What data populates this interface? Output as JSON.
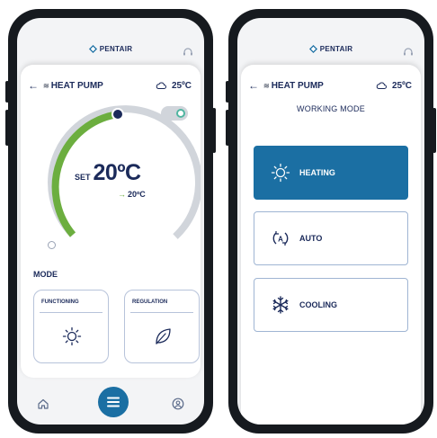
{
  "colors": {
    "brand_navy": "#1b2a5a",
    "accent_blue": "#1b6fa3",
    "arc_green": "#6cae3f",
    "arc_gray": "#d1d5db"
  },
  "brand": {
    "name": "PENTAIR"
  },
  "header": {
    "device_name": "HEAT PUMP",
    "outside_temp": "25ºC",
    "weather_icon": "cloud-icon",
    "support_icon": "headset-icon"
  },
  "thermostat": {
    "set_label": "SET",
    "set_value": "20ºC",
    "current_value": "20ºC",
    "arc_fill_fraction": 0.5,
    "power_on": true
  },
  "mode_section": {
    "title": "MODE",
    "tiles": [
      {
        "label": "FUNCTIONING",
        "icon": "sun-icon"
      },
      {
        "label": "REGULATION",
        "icon": "leaf-icon"
      }
    ]
  },
  "bottom_nav": {
    "icons": [
      "home-icon",
      "menu-icon",
      "user-icon"
    ]
  },
  "working_mode": {
    "title": "WORKING MODE",
    "options": [
      {
        "label": "HEATING",
        "icon": "sun-icon",
        "selected": true
      },
      {
        "label": "AUTO",
        "icon": "auto-icon",
        "selected": false
      },
      {
        "label": "COOLING",
        "icon": "snowflake-icon",
        "selected": false
      }
    ]
  }
}
